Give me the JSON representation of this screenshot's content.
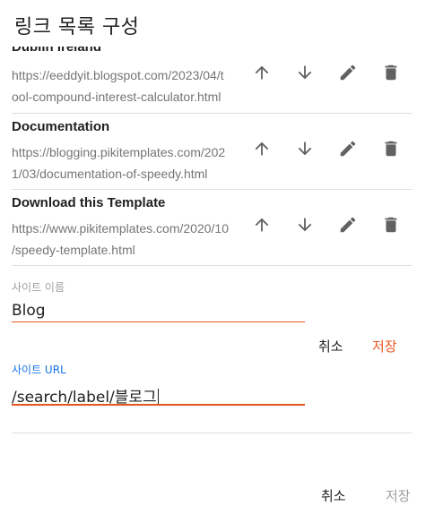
{
  "dialog": {
    "title": "링크 목록 구성"
  },
  "links": [
    {
      "name": "",
      "url_line1": "https://eeddyit.blogspot.com/2023/04/t",
      "url_line2": "ool-compound-interest-calculator.html"
    },
    {
      "name": "Documentation",
      "url_line1": "https://blogging.pikitemplates.com/202",
      "url_line2": "1/03/documentation-of-speedy.html"
    },
    {
      "name": "Download this Template",
      "url_line1": "https://www.pikitemplates.com/2020/10",
      "url_line2": "/speedy-template.html"
    }
  ],
  "icons": {
    "up": "arrow-up-icon",
    "down": "arrow-down-icon",
    "edit": "pencil-icon",
    "delete": "trash-icon"
  },
  "form": {
    "site_name_label": "사이트 이름",
    "site_name_value": "Blog",
    "inline_cancel": "취소",
    "inline_save": "저장",
    "site_url_label": "사이트 URL",
    "site_url_value": "/search/label/블로그"
  },
  "footer": {
    "cancel": "취소",
    "save": "저장"
  },
  "colors": {
    "accent": "#e8541e",
    "focus_label": "#1a73e8",
    "muted": "#9e9e9e"
  }
}
